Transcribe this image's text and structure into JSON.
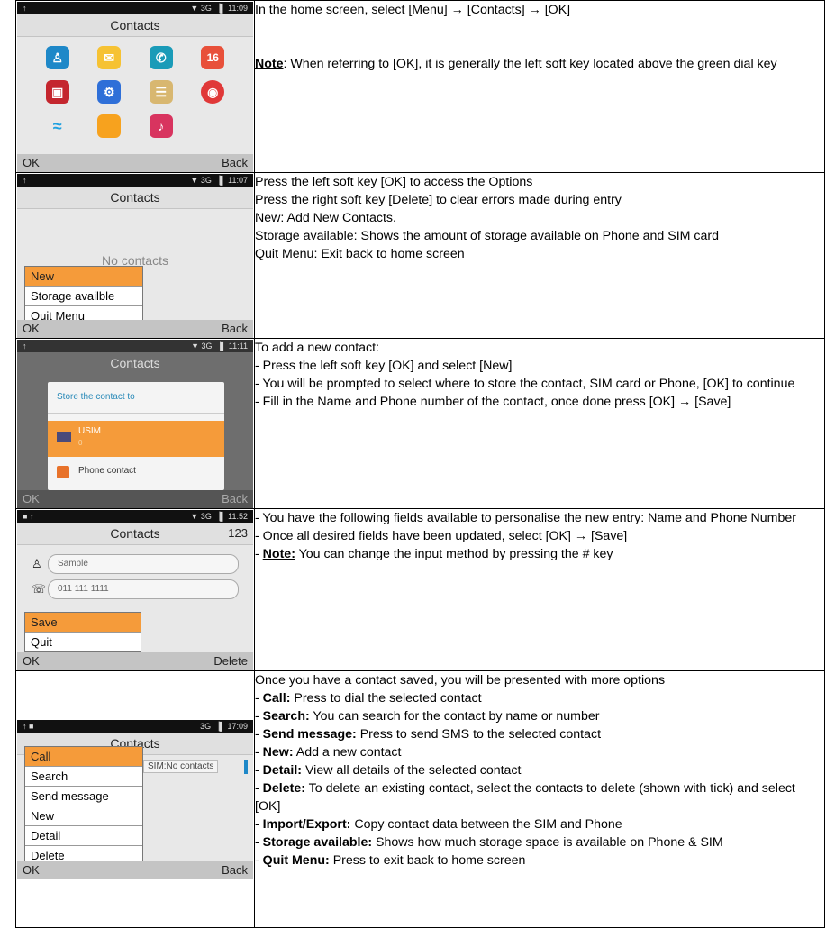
{
  "rows": [
    {
      "phone": {
        "status": "▼ 3G ▕▌ 11:09",
        "title": "Contacts",
        "soft_left": "OK",
        "soft_right": "Back",
        "icons": [
          "contacts-icon",
          "message-icon",
          "phone-icon",
          "calendar-icon",
          "toolbox-icon",
          "settings-icon",
          "notes-icon",
          "browser-icon",
          "wifi-icon",
          "files-icon",
          "music-icon"
        ],
        "calendar_num": "16"
      },
      "text": {
        "line1": "In the home screen, select [Menu] → [Contacts] → [OK]",
        "note_label": "Note",
        "note_text": ": When referring to [OK], it is generally the left soft key located above the green dial key"
      }
    },
    {
      "phone": {
        "status": "▼ 3G ▕▌ 11:07",
        "title": "Contacts",
        "empty": "No contacts",
        "menu": [
          "New",
          "Storage availble",
          "Quit Menu"
        ],
        "soft_left": "OK",
        "soft_right": "Back"
      },
      "text": {
        "lines": [
          "Press the left soft key [OK] to access the Options",
          "Press the right soft key [Delete] to clear errors made during entry",
          "New: Add New Contacts.",
          "Storage available: Shows the amount of storage available on Phone and SIM card",
          "Quit Menu: Exit back to home screen"
        ]
      }
    },
    {
      "phone": {
        "status": "▼ 3G ▕▌ 11:11",
        "title": "Contacts",
        "dialog_title": "Store the contact to",
        "opt1": "USIM",
        "opt1_sub": "0",
        "opt2": "Phone contact",
        "soft_left": "OK",
        "soft_right": "Back"
      },
      "text": {
        "lines": [
          "To add a new contact:",
          "- Press the left soft key [OK] and select [New]",
          "- You will be prompted to select where to store the contact, SIM card or Phone, [OK] to continue",
          "- Fill in the Name and Phone number of the contact, once done press [OK] → [Save]"
        ]
      }
    },
    {
      "phone": {
        "status": "▼ 3G ▕▌ 11:52",
        "title": "Contacts",
        "title_right": "123",
        "name_value": "Sample",
        "number_value": "011 111 1111",
        "menu": [
          "Save",
          "Quit"
        ],
        "soft_left": "OK",
        "soft_right": "Delete"
      },
      "text": {
        "line1": "- You have the following fields available to personalise the new entry: Name and Phone Number",
        "line2": "- Once all desired fields have been updated, select [OK] → [Save]",
        "note_prefix": "- ",
        "note_label": "Note:",
        "note_text": " You can change the input method by pressing the # key"
      }
    },
    {
      "phone": {
        "status": "3G ▕▌ 17:09",
        "title": "Contacts",
        "sim_label": "SIM:No contacts",
        "menu": [
          "Call",
          "Search",
          "Send message",
          "New",
          "Detail",
          "Delete"
        ],
        "soft_left": "OK",
        "soft_right": "Back"
      },
      "text": {
        "intro": "Once you have a contact saved, you will be presented with more options",
        "items": [
          {
            "label": "Call:",
            "text": " Press to dial the selected contact"
          },
          {
            "label": "Search:",
            "text": " You can search for the contact by name or number"
          },
          {
            "label": "Send message:",
            "text": " Press to send SMS to the selected contact"
          },
          {
            "label": "New:",
            "text": " Add a new contact"
          },
          {
            "label": "Detail:",
            "text": " View all details of the selected contact"
          },
          {
            "label": "Delete:",
            "text": " To delete an existing contact, select the contacts to delete (shown with tick) and select [OK]"
          },
          {
            "label": "Import/Export:",
            "text": " Copy contact data between the SIM and Phone"
          },
          {
            "label": "Storage available:",
            "text": " Shows how much storage space is available on Phone & SIM"
          },
          {
            "label": "Quit Menu:",
            "text": " Press to exit back to home screen"
          }
        ]
      }
    }
  ],
  "colors": {
    "accent": "#f59b3a",
    "softbar": "#c4c4c4"
  }
}
